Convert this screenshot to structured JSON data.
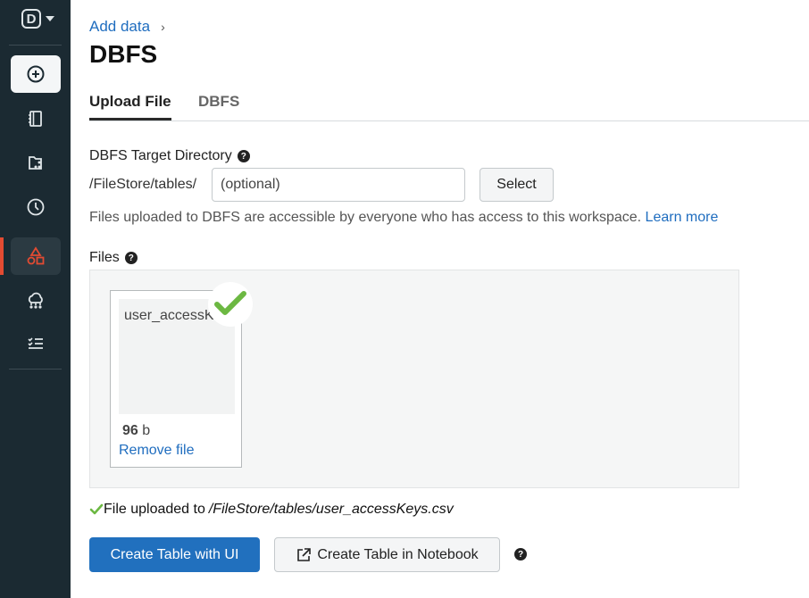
{
  "sidebar": {
    "logo_letter": "D",
    "items": [
      {
        "icon": "plus-circle-icon"
      },
      {
        "icon": "notebook-icon"
      },
      {
        "icon": "repos-icon"
      },
      {
        "icon": "clock-icon"
      },
      {
        "icon": "data-shapes-icon",
        "active": true
      },
      {
        "icon": "cluster-icon"
      },
      {
        "icon": "jobs-list-icon"
      }
    ],
    "accent_color": "#e34b32"
  },
  "breadcrumb": {
    "link": "Add data",
    "separator": "›"
  },
  "page": {
    "title": "DBFS"
  },
  "tabs": [
    {
      "label": "Upload File",
      "active": true
    },
    {
      "label": "DBFS",
      "active": false
    }
  ],
  "target_dir": {
    "label": "DBFS Target Directory",
    "prefix": "/FileStore/tables/",
    "placeholder": "(optional)",
    "select_label": "Select",
    "info_text": "Files uploaded to DBFS are accessible by everyone who has access to this workspace.",
    "learn_more": "Learn more"
  },
  "files": {
    "label": "Files",
    "items": [
      {
        "name_preview": "user_accessKe",
        "size_value": "96",
        "size_unit": "b",
        "remove_label": "Remove file",
        "status": "uploaded"
      }
    ]
  },
  "upload_status": {
    "text": "File uploaded to",
    "path": "/FileStore/tables/user_accessKeys.csv"
  },
  "actions": {
    "create_ui": "Create Table with UI",
    "create_notebook": "Create Table in Notebook"
  },
  "colors": {
    "primary": "#2170be",
    "link": "#1f6dbf",
    "success": "#6cb842",
    "sidebar_bg": "#1b2a32"
  }
}
